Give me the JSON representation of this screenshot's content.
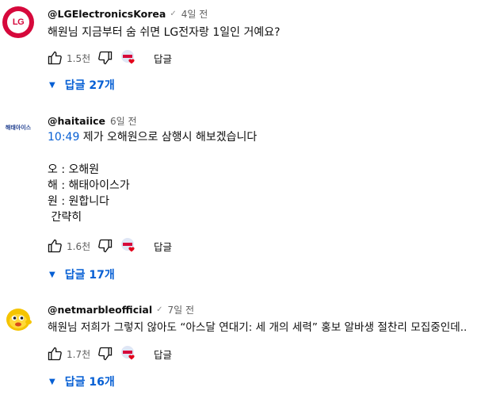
{
  "comments": [
    {
      "author": "@LGElectronicsKorea",
      "verified": "✓",
      "time": "4일 전",
      "lines": [
        "해원님 지금부터 숨 쉬면 LG전자랑 1일인 거예요?"
      ],
      "likes": "1.5천",
      "reply_label": "답글",
      "replies_label": "답글 27개",
      "avatar_text": "LG"
    },
    {
      "author": "@haitaiice",
      "time": "6일 전",
      "timestamp": "10:49",
      "line1_rest": " 제가 오해원으로 삼행시 해보겠습니다",
      "lines": [
        "오 : 오해원",
        "해 : 해태아이스가",
        "원 : 원합니다",
        " 간략히"
      ],
      "likes": "1.6천",
      "reply_label": "답글",
      "replies_label": "답글 17개",
      "avatar_text": "해태아이스"
    },
    {
      "author": "@netmarbleofficial",
      "verified": "✓",
      "time": "7일 전",
      "lines": [
        "해원님 저희가 그렇지 않아도 “아스달 연대기: 세 개의 세력” 홍보 알바생 절찬리 모집중인데.."
      ],
      "likes": "1.7천",
      "reply_label": "답글",
      "replies_label": "답글 16개"
    }
  ],
  "colors": {
    "link": "#065fd4",
    "lg_red": "#d6083b",
    "muted": "#606060"
  },
  "icons": [
    "thumb-up-icon",
    "thumb-down-icon",
    "creator-heart-icon",
    "expand-triangle-icon"
  ]
}
